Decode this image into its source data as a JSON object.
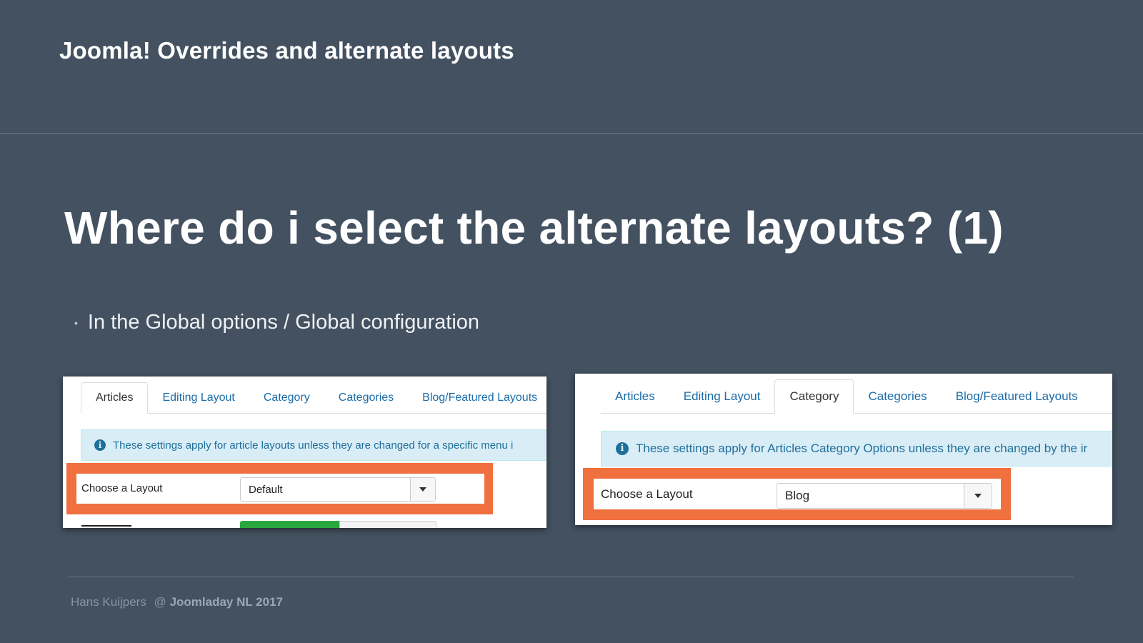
{
  "header": {
    "title": "Joomla! Overrides and alternate layouts"
  },
  "slide": {
    "title": "Where do i select the alternate layouts? (1)",
    "bullet": "In the Global options / Global configuration"
  },
  "screenshot_left": {
    "tabs": [
      {
        "label": "Articles",
        "active": true
      },
      {
        "label": "Editing Layout",
        "active": false
      },
      {
        "label": "Category",
        "active": false
      },
      {
        "label": "Categories",
        "active": false
      },
      {
        "label": "Blog/Featured Layouts",
        "active": false
      }
    ],
    "info_icon": "i",
    "info_text": "These settings apply for article layouts unless they are changed for a specific menu i",
    "field_label": "Choose a Layout",
    "select_value": "Default"
  },
  "screenshot_right": {
    "tabs": [
      {
        "label": "Articles",
        "active": false
      },
      {
        "label": "Editing Layout",
        "active": false
      },
      {
        "label": "Category",
        "active": true
      },
      {
        "label": "Categories",
        "active": false
      },
      {
        "label": "Blog/Featured Layouts",
        "active": false
      }
    ],
    "info_icon": "i",
    "info_text": "These settings apply for Articles Category Options unless they are changed by the ir",
    "field_label": "Choose a Layout",
    "select_value": "Blog"
  },
  "footer": {
    "author": "Hans Kuijpers",
    "separator": "@",
    "event": "Joomladay NL 2017"
  },
  "colors": {
    "background": "#435160",
    "highlight": "#f0703f",
    "link": "#1b6ca8",
    "info_bg": "#d9edf7",
    "toggle_green": "#2aa63f"
  }
}
